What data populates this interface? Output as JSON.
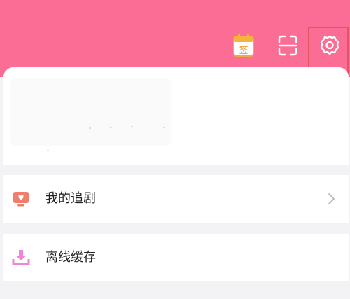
{
  "header": {
    "checkin_icon_char": "签",
    "colors": {
      "header_bg": "#fb6d95",
      "icon": "#ffffff",
      "checkin_top": "#f6b23a",
      "highlight_border": "#e35561"
    },
    "icons": [
      "calendar-checkin-icon",
      "scan-icon",
      "gear-icon"
    ]
  },
  "menu": {
    "items": [
      {
        "label": "我的追剧",
        "icon": "tv-icon",
        "icon_color": "#ef7f6a"
      },
      {
        "label": "离线缓存",
        "icon": "download-icon",
        "icon_color": "#f183d8"
      }
    ]
  }
}
